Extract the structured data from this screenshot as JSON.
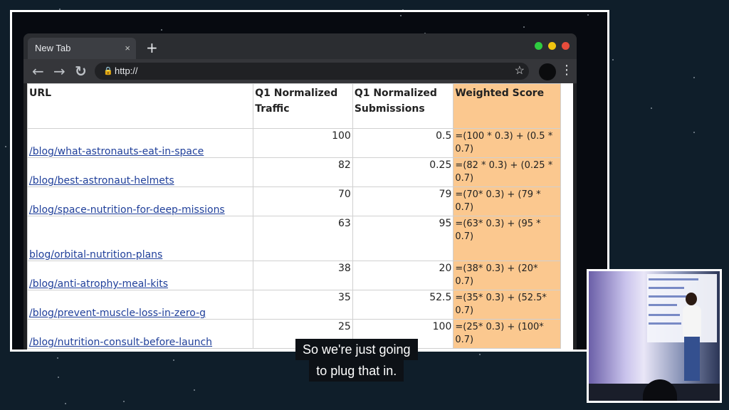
{
  "browser": {
    "tab_title": "New Tab",
    "tab_close": "×",
    "new_tab": "+",
    "back": "←",
    "forward": "→",
    "reload": "↻",
    "url": "http://",
    "bookmark": "☆",
    "menu": "⋮",
    "window_dots": [
      "#2ecc40",
      "#f1c40f",
      "#e74c3c"
    ]
  },
  "sheet": {
    "headers": [
      "URL",
      "Q1 Normalized Traffic",
      "Q1 Normalized Submissions",
      "Weighted Score"
    ],
    "rows": [
      {
        "url": "/blog/what-astronauts-eat-in-space",
        "traffic": "100",
        "submissions": "0.5",
        "formula": "=(100 * 0.3) + (0.5 * 0.7)"
      },
      {
        "url": "/blog/best-astronaut-helmets",
        "traffic": "82",
        "submissions": "0.25",
        "formula": "=(82 * 0.3) + (0.25 * 0.7)"
      },
      {
        "url": "/blog/space-nutrition-for-deep-missions",
        "traffic": "70",
        "submissions": "79",
        "formula": "=(70* 0.3) + (79 * 0.7)"
      },
      {
        "url": "blog/orbital-nutrition-plans",
        "traffic": "63",
        "submissions": "95",
        "formula": "=(63* 0.3) + (95 * 0.7)"
      },
      {
        "url": "/blog/anti-atrophy-meal-kits",
        "traffic": "38",
        "submissions": "20",
        "formula": "=(38* 0.3) + (20* 0.7)"
      },
      {
        "url": "/blog/prevent-muscle-loss-in-zero-g",
        "traffic": "35",
        "submissions": "52.5",
        "formula": "=(35* 0.3) + (52.5* 0.7)"
      },
      {
        "url": "/blog/nutrition-consult-before-launch",
        "traffic": "25",
        "submissions": "100",
        "formula": "=(25* 0.3) + (100* 0.7)"
      }
    ]
  },
  "caption": {
    "line1": "So we're just going",
    "line2": "to plug that in."
  },
  "colors": {
    "weighted_score_fill": "#fbc88f",
    "link": "#1f3f9a",
    "background": "#0f1e2a"
  }
}
